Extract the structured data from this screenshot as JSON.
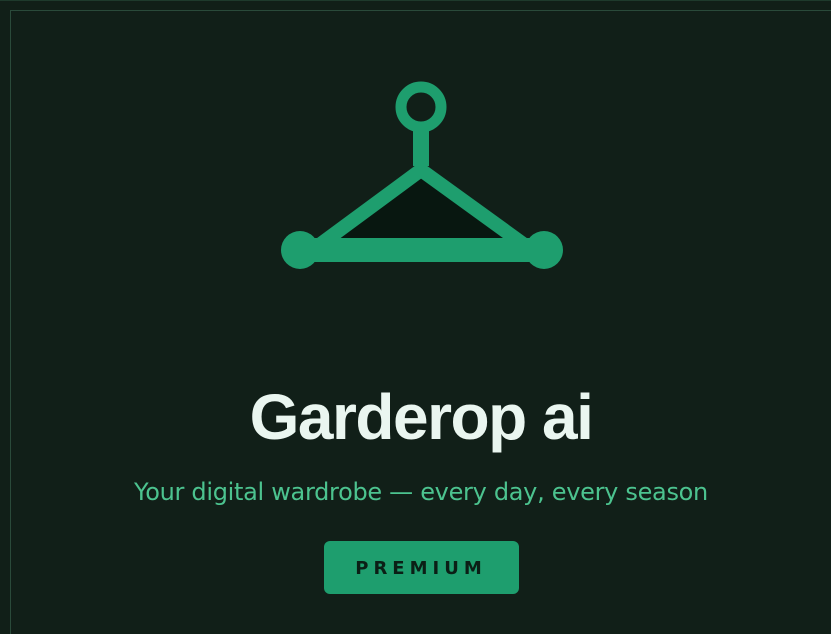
{
  "app": {
    "title": "Garderop ai",
    "tagline": "Your digital wardrobe — every day, every season",
    "badge_label": "PREMIUM"
  },
  "logo": {
    "icon": "hanger-icon",
    "color": "#1e9e6e",
    "fill": "#081710"
  },
  "colors": {
    "background": "#111f18",
    "accent": "#1e9e6e",
    "title": "#eaf6f0",
    "tagline": "#4cc38f"
  }
}
